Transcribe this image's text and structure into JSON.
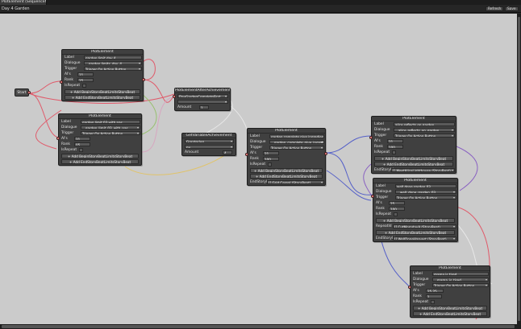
{
  "tab": {
    "title": "PlotElement (SequenceNo..."
  },
  "toolbar": {
    "breadcrumb": "Day 4 Garden",
    "refresh_label": "Refresh",
    "save_label": "Save"
  },
  "start_node": {
    "label": "Start"
  },
  "field_labels": {
    "label": "Label",
    "dialogue": "Dialogue",
    "trigger": "Trigger",
    "ai": "AI's",
    "rank": "Rank",
    "is_repeat": "IsRepeat",
    "end_story": "EndStoryId",
    "repeat_id": "RepeatId",
    "amount": "Amount"
  },
  "button_labels": {
    "add_begin": "+ Add BeginStoryBeatLimitsStoryBeat",
    "add_end": "+ Add EndStoryBeatLimitsStoryBeat"
  },
  "nodes": {
    "n1": {
      "title": "PlotElement",
      "label": "garden limit day 4",
      "dialogue": "...garden limits_day_4",
      "trigger": "Trigger On Action Button",
      "ai": "21",
      "rank": "25"
    },
    "n2": {
      "title": "PlotElement",
      "label": "garden limit 03 with nas",
      "dialogue": "...garden_limit_03_with_nas",
      "trigger": "Trigger On Action Button",
      "ai": "21",
      "rank": "05"
    },
    "n3": {
      "title": "PlotElementAfterAchievement",
      "value": "DayGardenCompleteFirst",
      "amount": "1"
    },
    "n4": {
      "title": "GetVariableAchievement",
      "op": "Greater/eq",
      "value": "nv",
      "amount": "4"
    },
    "n5": {
      "title": "PlotElement",
      "label": "garden complete give ingredient lunch",
      "dialogue": "...garden_complete_give_ingredient",
      "trigger": "Trigger On Action Button",
      "ai": "21",
      "rank": "100",
      "end_story": "[] Grid Cereal (StoryBeat)"
    },
    "n6": {
      "title": "PlotElement",
      "label": "alice reflects on garden",
      "dialogue": "...alice_reflects_on_garden",
      "trigger": "Trigger On Action Button",
      "ai": "21",
      "rank": "100",
      "end_story": "[] MeetAliceLighthouse (StoryBeat)"
    },
    "n7": {
      "title": "PlotElement",
      "label": "well done garden 03",
      "dialogue": "...well_done_garden_03",
      "trigger": "Trigger On Action Button",
      "ai": "25",
      "rank": "100",
      "repeat_id": "[] CutMorndayA (StoryBeat)",
      "end_story": "[] WellDoneHarvest (StoryBeat)"
    },
    "n8": {
      "title": "PlotElement",
      "label": "mama is tired",
      "dialogue": "...mama_is_tired",
      "trigger": "Trigger On Action Button",
      "ai": "25 25",
      "rank": "1"
    }
  },
  "colors": {
    "canvas": "#cbcbcb",
    "node": "#404040",
    "wire_red": "#e05a6a",
    "wire_blue": "#5560c8",
    "wire_purple": "#8a62c2",
    "wire_white": "#e8e8e8"
  }
}
